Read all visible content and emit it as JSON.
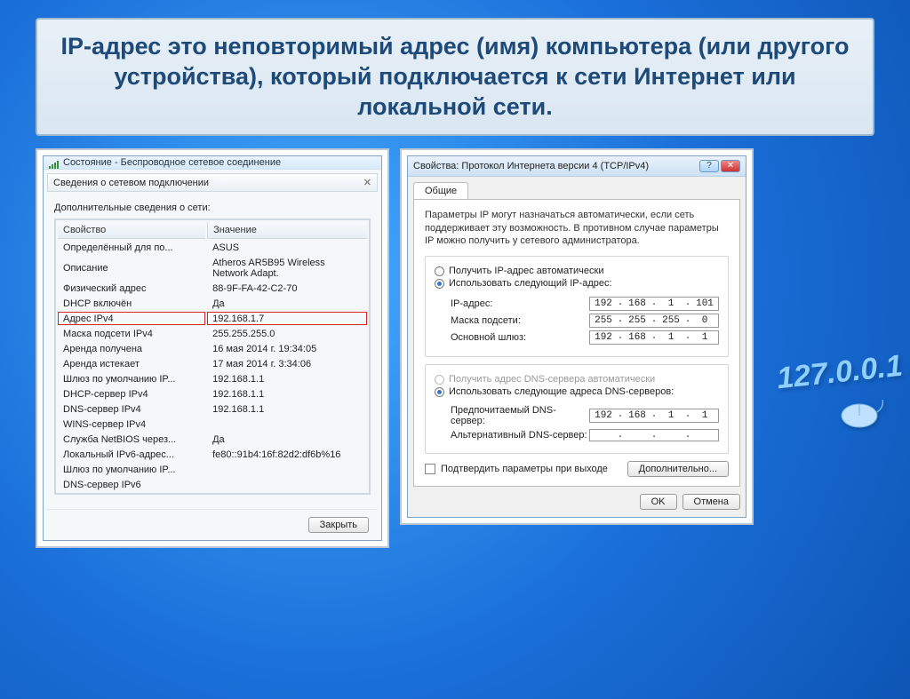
{
  "slide_title": "IP-адрес это неповторимый адрес (имя) компьютера (или другого устройства), который подключается к сети Интернет или локальной сети.",
  "left": {
    "status_title": "Состояние - Беспроводное сетевое соединение",
    "inner_title": "Сведения о сетевом подключении",
    "subhead": "Дополнительные сведения о сети:",
    "col_prop": "Свойство",
    "col_val": "Значение",
    "rows": [
      {
        "p": "Определённый для по...",
        "v": "ASUS"
      },
      {
        "p": "Описание",
        "v": "Atheros AR5B95 Wireless Network Adapt."
      },
      {
        "p": "Физический адрес",
        "v": "88-9F-FA-42-C2-70"
      },
      {
        "p": "DHCP включён",
        "v": "Да"
      },
      {
        "p": "Адрес IPv4",
        "v": "192.168.1.7",
        "hl": true
      },
      {
        "p": "Маска подсети IPv4",
        "v": "255.255.255.0"
      },
      {
        "p": "Аренда получена",
        "v": "16 мая 2014 г. 19:34:05"
      },
      {
        "p": "Аренда истекает",
        "v": "17 мая 2014 г. 3:34:06"
      },
      {
        "p": "Шлюз по умолчанию IP...",
        "v": "192.168.1.1"
      },
      {
        "p": "DHCP-сервер IPv4",
        "v": "192.168.1.1"
      },
      {
        "p": "DNS-сервер IPv4",
        "v": "192.168.1.1"
      },
      {
        "p": "WINS-сервер IPv4",
        "v": ""
      },
      {
        "p": "Служба NetBIOS через...",
        "v": "Да"
      },
      {
        "p": "Локальный IPv6-адрес...",
        "v": "fe80::91b4:16f:82d2:df6b%16"
      },
      {
        "p": "Шлюз по умолчанию IP...",
        "v": ""
      },
      {
        "p": "DNS-сервер IPv6",
        "v": ""
      }
    ],
    "close_btn": "Закрыть"
  },
  "right": {
    "title": "Свойства: Протокол Интернета версии 4 (TCP/IPv4)",
    "tab": "Общие",
    "desc": "Параметры IP могут назначаться автоматически, если сеть поддерживает эту возможность. В противном случае параметры IP можно получить у сетевого администратора.",
    "r_auto_ip": "Получить IP-адрес автоматически",
    "r_manual_ip": "Использовать следующий IP-адрес:",
    "f_ip": "IP-адрес:",
    "f_mask": "Маска подсети:",
    "f_gw": "Основной шлюз:",
    "ip": [
      "192",
      "168",
      "1",
      "101"
    ],
    "mask": [
      "255",
      "255",
      "255",
      "0"
    ],
    "gw": [
      "192",
      "168",
      "1",
      "1"
    ],
    "r_auto_dns": "Получить адрес DNS-сервера автоматически",
    "r_manual_dns": "Использовать следующие адреса DNS-серверов:",
    "f_dns1": "Предпочитаемый DNS-сервер:",
    "f_dns2": "Альтернативный DNS-сервер:",
    "dns1": [
      "192",
      "168",
      "1",
      "1"
    ],
    "chk": "Подтвердить параметры при выходе",
    "more": "Дополнительно...",
    "ok": "OK",
    "cancel": "Отмена"
  },
  "deco": "127.0.0.1"
}
